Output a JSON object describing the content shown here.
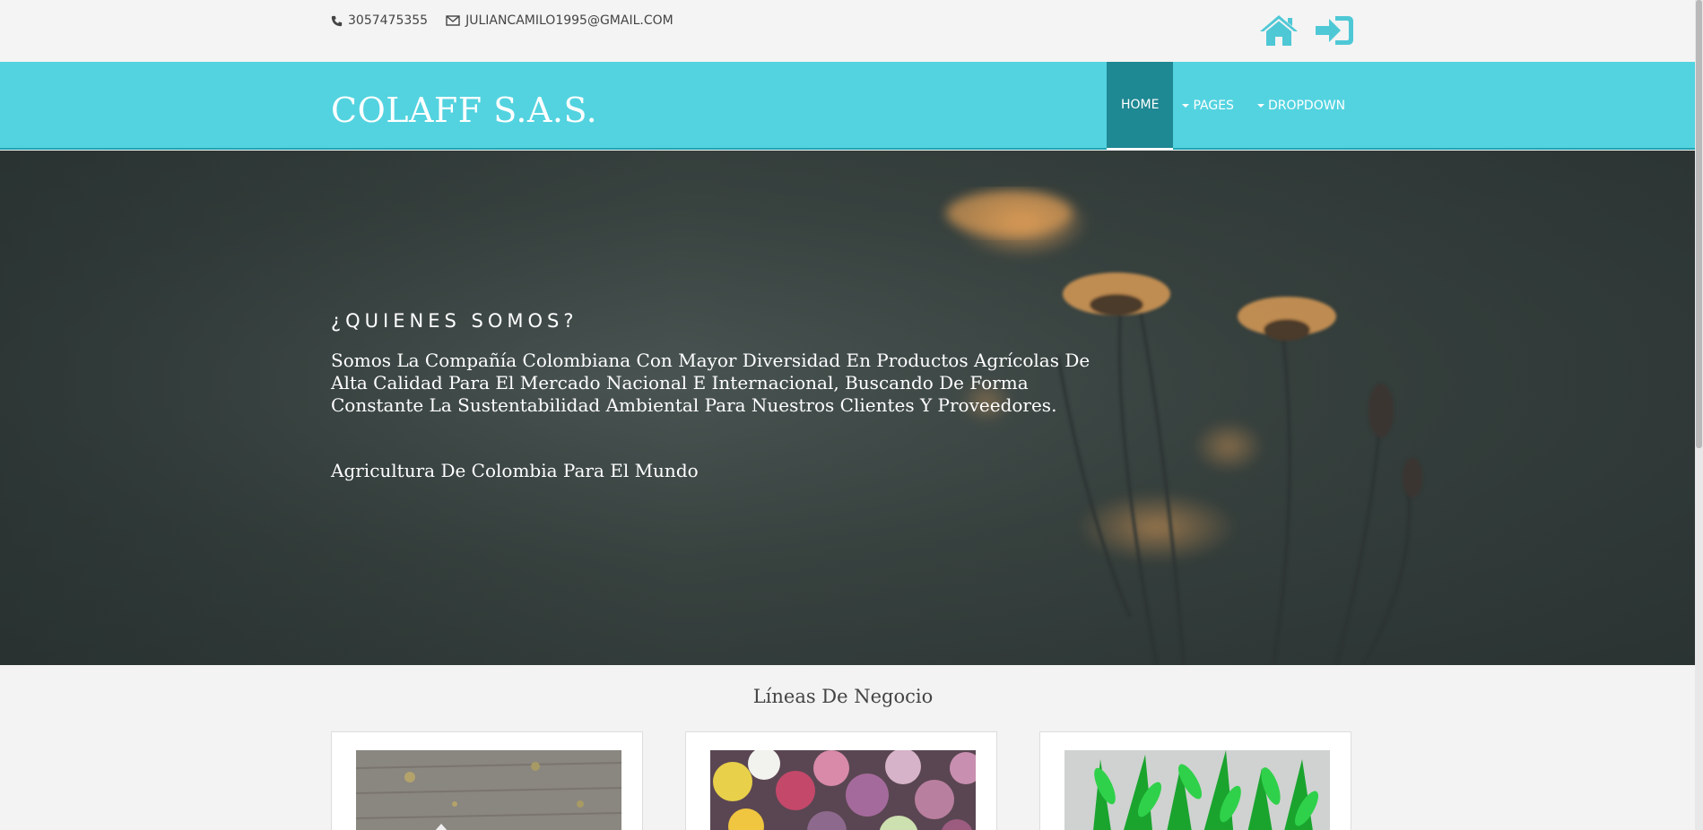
{
  "contact": {
    "phone": "3057475355",
    "email": "JULIANCAMILO1995@GMAIL.COM"
  },
  "header": {
    "brand": "COLAFF S.A.S.",
    "nav": [
      {
        "label": "HOME"
      },
      {
        "label": "PAGES"
      },
      {
        "label": "DROPDOWN"
      }
    ]
  },
  "hero": {
    "heading": "¿QUIENES SOMOS?",
    "description": "Somos La Compañía Colombiana Con Mayor Diversidad En Productos Agrícolas De Alta Calidad Para El Mercado Nacional E Internacional, Buscando De Forma Constante La Sustentabilidad Ambiental Para Nuestros Clientes Y Proveedores.",
    "tagline": "Agricultura De Colombia Para El Mundo"
  },
  "section": {
    "title": "Líneas De Negocio"
  },
  "colors": {
    "accent": "#53d3e0",
    "accent_dark": "#1e8893",
    "icon": "#4fc8d6"
  },
  "icons": {
    "phone": "phone-icon",
    "email": "envelope-icon",
    "home": "home-icon",
    "login": "sign-in-icon"
  }
}
